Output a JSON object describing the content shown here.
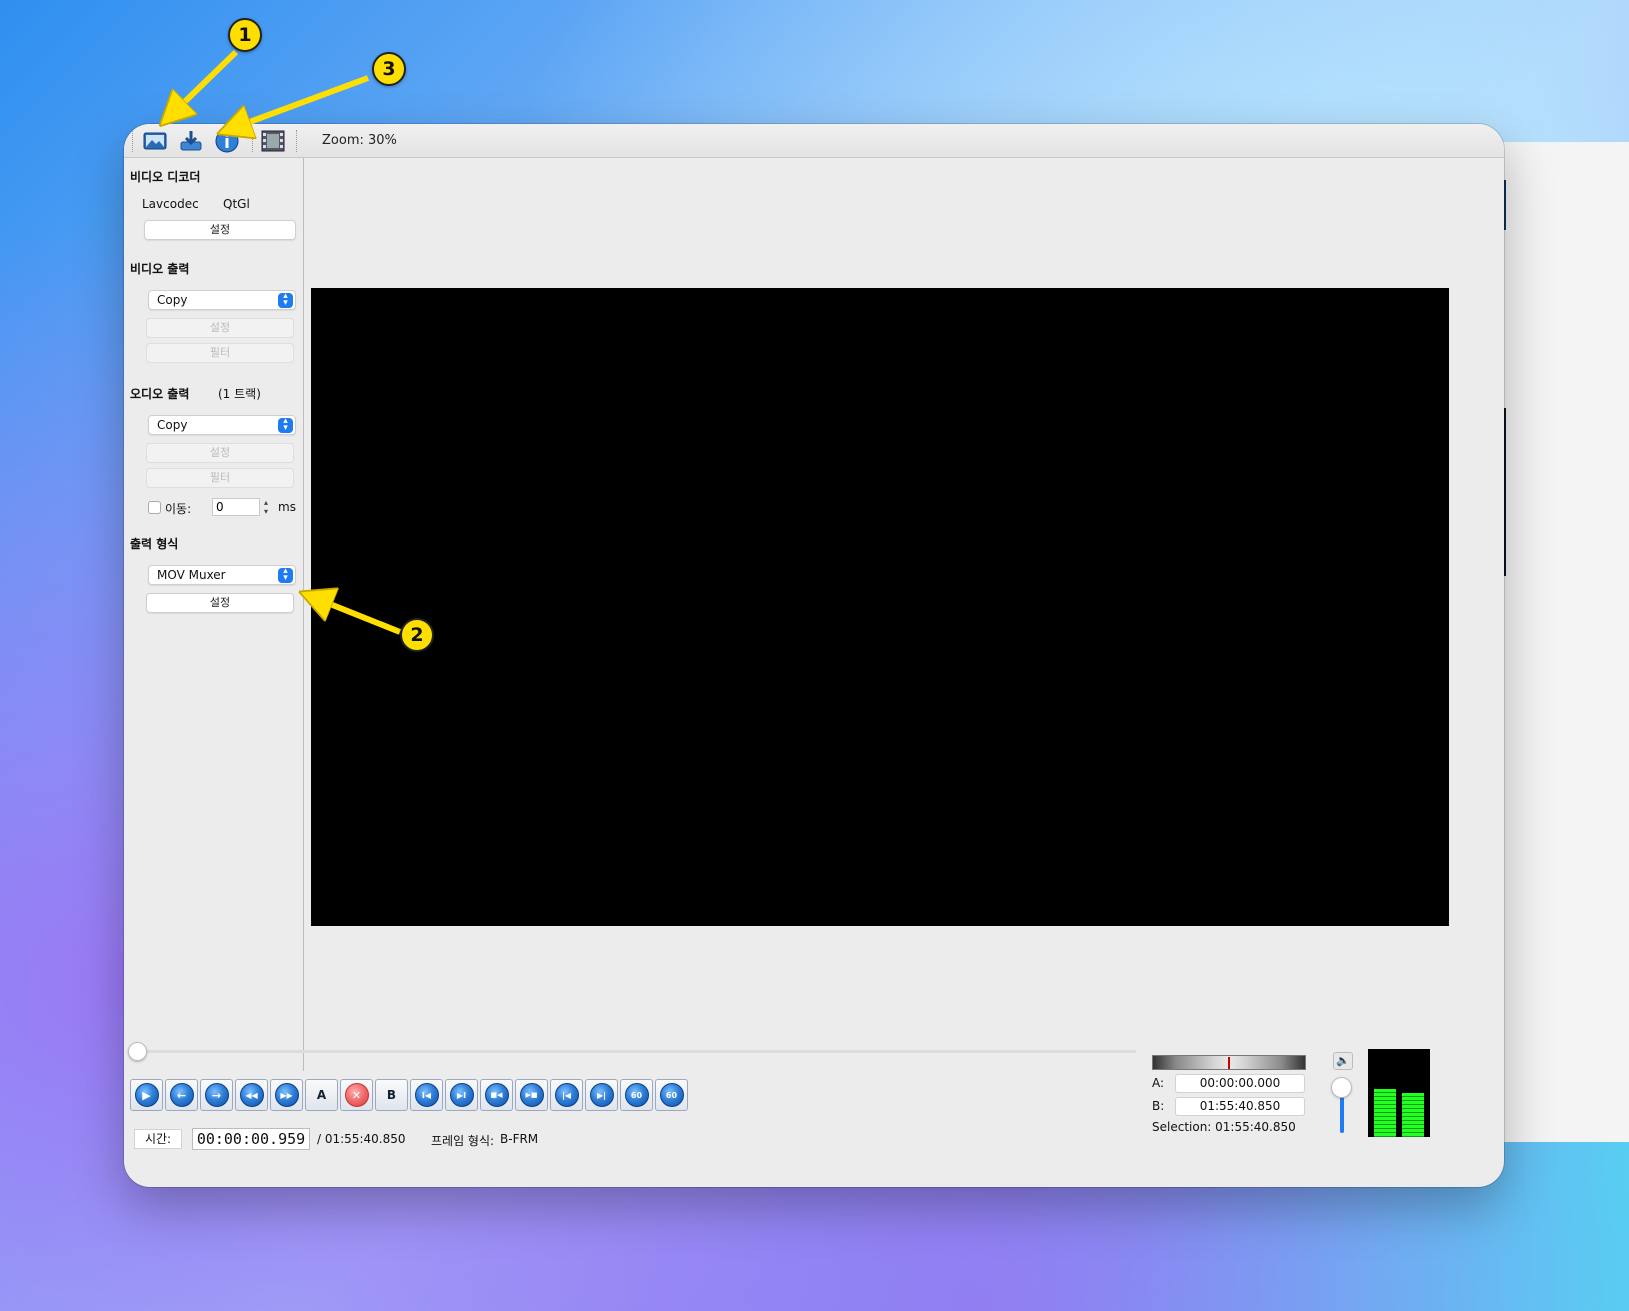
{
  "toolbar": {
    "icons": [
      "open-video-icon",
      "save-video-icon",
      "info-icon",
      "film-icon"
    ],
    "zoom_label": "Zoom: 30%"
  },
  "panel": {
    "video_decoder": {
      "title": "비디오 디코더",
      "decoder": "Lavcodec",
      "renderer": "QtGl",
      "settings_label": "설정"
    },
    "video_output": {
      "title": "비디오 출력",
      "codec_value": "Copy",
      "settings_label": "설정",
      "filter_label": "필터"
    },
    "audio_output": {
      "title": "오디오 출력",
      "tracks": "(1 트랙)",
      "codec_value": "Copy",
      "settings_label": "설정",
      "filter_label": "필터",
      "shift_label": "이동:",
      "shift_value": "0",
      "shift_unit": "ms"
    },
    "output_format": {
      "title": "출력 형식",
      "muxer_value": "MOV Muxer",
      "settings_label": "설정"
    }
  },
  "controls": {
    "buttons": [
      {
        "name": "play-button",
        "glyph": "▶"
      },
      {
        "name": "prev-frame-button",
        "glyph": "←"
      },
      {
        "name": "next-frame-button",
        "glyph": "→"
      },
      {
        "name": "prev-keyframe-button",
        "glyph": "◀◀"
      },
      {
        "name": "next-keyframe-button",
        "glyph": "▶▶"
      },
      {
        "name": "set-marker-a-button",
        "glyph": "A"
      },
      {
        "name": "delete-button",
        "glyph": "✕"
      },
      {
        "name": "set-marker-b-button",
        "glyph": "B"
      },
      {
        "name": "go-marker-a-button",
        "glyph": "I◀"
      },
      {
        "name": "go-marker-b-button",
        "glyph": "▶I"
      },
      {
        "name": "prev-black-frame-button",
        "glyph": "■◀"
      },
      {
        "name": "next-black-frame-button",
        "glyph": "▶■"
      },
      {
        "name": "go-start-button",
        "glyph": "|◀"
      },
      {
        "name": "go-end-button",
        "glyph": "▶|"
      },
      {
        "name": "back-60-button",
        "glyph": "60"
      },
      {
        "name": "forward-60-button",
        "glyph": "60"
      }
    ],
    "time_label": "시간:",
    "current_time": "00:00:00.959",
    "total_time": "/ 01:55:40.850",
    "frame_type_label": "프레임 형식:",
    "frame_type_value": "B-FRM"
  },
  "selection": {
    "a_label": "A:",
    "a_value": "00:00:00.000",
    "b_label": "B:",
    "b_value": "01:55:40.850",
    "selection_text": "Selection: 01:55:40.850"
  },
  "audio_meter": {
    "left_level": 0.55,
    "right_level": 0.5
  },
  "annotations": [
    "1",
    "2",
    "3"
  ],
  "colors": {
    "accent": "#1f7bf2",
    "annotation": "#ffdf00",
    "video_bg": "#000000"
  }
}
